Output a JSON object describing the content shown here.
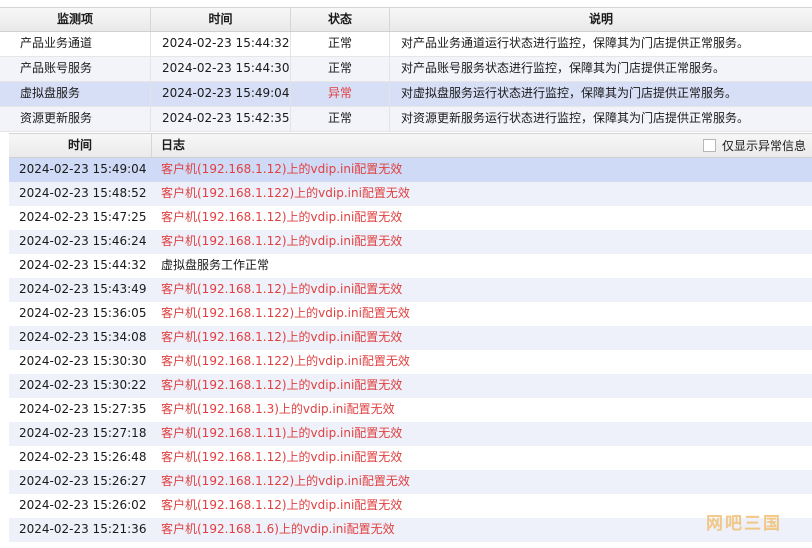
{
  "monitor": {
    "headers": {
      "item": "监测项",
      "time": "时间",
      "status": "状态",
      "desc": "说明"
    },
    "rows": [
      {
        "item": "产品业务通道",
        "time": "2024-02-23 15:44:32",
        "status": "正常",
        "desc": "对产品业务通道运行状态进行监控，保障其为门店提供正常服务。"
      },
      {
        "item": "产品账号服务",
        "time": "2024-02-23 15:44:30",
        "status": "正常",
        "desc": "对产品账号服务状态进行监控，保障其为门店提供正常服务。"
      },
      {
        "item": "虚拟盘服务",
        "time": "2024-02-23 15:49:04",
        "status": "异常",
        "desc": "对虚拟盘服务运行状态进行监控，保障其为门店提供正常服务。"
      },
      {
        "item": "资源更新服务",
        "time": "2024-02-23 15:42:35",
        "status": "正常",
        "desc": "对资源更新服务运行状态进行监控，保障其为门店提供正常服务。"
      }
    ]
  },
  "log": {
    "headers": {
      "time": "时间",
      "log": "日志"
    },
    "filter_label": "仅显示异常信息",
    "filter_checked": false,
    "rows": [
      {
        "time": "2024-02-23 15:49:04",
        "msg": "客户机(192.168.1.12)上的vdip.ini配置无效",
        "error": true
      },
      {
        "time": "2024-02-23 15:48:52",
        "msg": "客户机(192.168.1.122)上的vdip.ini配置无效",
        "error": true
      },
      {
        "time": "2024-02-23 15:47:25",
        "msg": "客户机(192.168.1.12)上的vdip.ini配置无效",
        "error": true
      },
      {
        "time": "2024-02-23 15:46:24",
        "msg": "客户机(192.168.1.12)上的vdip.ini配置无效",
        "error": true
      },
      {
        "time": "2024-02-23 15:44:32",
        "msg": "虚拟盘服务工作正常",
        "error": false
      },
      {
        "time": "2024-02-23 15:43:49",
        "msg": "客户机(192.168.1.12)上的vdip.ini配置无效",
        "error": true
      },
      {
        "time": "2024-02-23 15:36:05",
        "msg": "客户机(192.168.1.122)上的vdip.ini配置无效",
        "error": true
      },
      {
        "time": "2024-02-23 15:34:08",
        "msg": "客户机(192.168.1.12)上的vdip.ini配置无效",
        "error": true
      },
      {
        "time": "2024-02-23 15:30:30",
        "msg": "客户机(192.168.1.122)上的vdip.ini配置无效",
        "error": true
      },
      {
        "time": "2024-02-23 15:30:22",
        "msg": "客户机(192.168.1.12)上的vdip.ini配置无效",
        "error": true
      },
      {
        "time": "2024-02-23 15:27:35",
        "msg": "客户机(192.168.1.3)上的vdip.ini配置无效",
        "error": true
      },
      {
        "time": "2024-02-23 15:27:18",
        "msg": "客户机(192.168.1.11)上的vdip.ini配置无效",
        "error": true
      },
      {
        "time": "2024-02-23 15:26:48",
        "msg": "客户机(192.168.1.12)上的vdip.ini配置无效",
        "error": true
      },
      {
        "time": "2024-02-23 15:26:27",
        "msg": "客户机(192.168.1.122)上的vdip.ini配置无效",
        "error": true
      },
      {
        "time": "2024-02-23 15:26:02",
        "msg": "客户机(192.168.1.12)上的vdip.ini配置无效",
        "error": true
      },
      {
        "time": "2024-02-23 15:21:36",
        "msg": "客户机(192.168.1.6)上的vdip.ini配置无效",
        "error": true
      }
    ]
  },
  "watermark": "网吧三国",
  "colors": {
    "error": "#e04040",
    "selected": "#d7dff6"
  }
}
